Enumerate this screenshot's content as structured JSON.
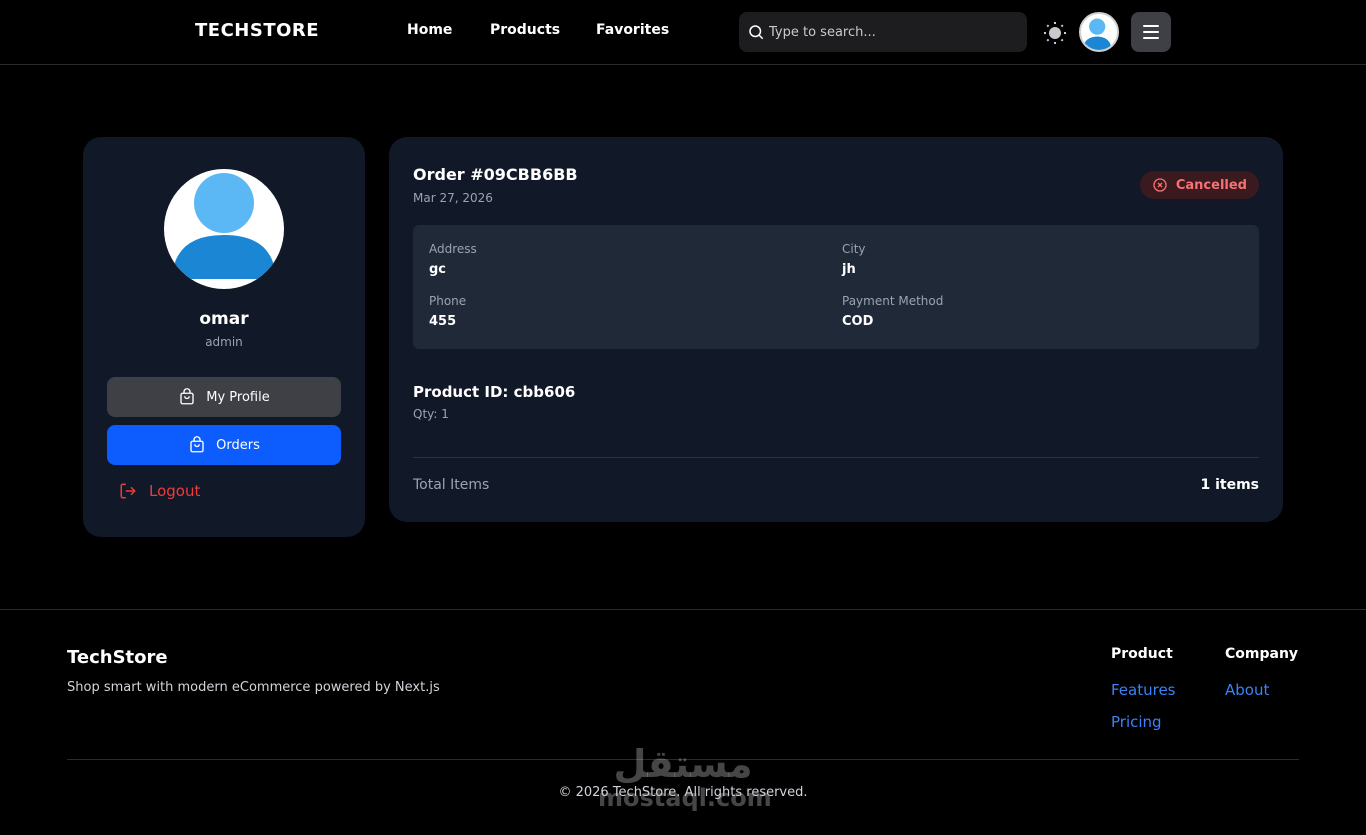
{
  "header": {
    "logo": "TECHSTORE",
    "nav": {
      "home": "Home",
      "products": "Products",
      "favorites": "Favorites"
    },
    "search_placeholder": "Type to search..."
  },
  "sidebar": {
    "username": "omar",
    "role": "admin",
    "my_profile_label": "My Profile",
    "orders_label": "Orders",
    "logout_label": "Logout"
  },
  "order": {
    "title": "Order #09CBB6BB",
    "date": "Mar 27, 2026",
    "status": "Cancelled",
    "address_label": "Address",
    "address": "gc",
    "city_label": "City",
    "city": "jh",
    "phone_label": "Phone",
    "phone": "455",
    "payment_label": "Payment Method",
    "payment": "COD",
    "product_id": "Product ID: cbb606",
    "qty": "Qty: 1",
    "total_label": "Total Items",
    "total_value": "1 items"
  },
  "footer": {
    "brand": "TechStore",
    "tagline": "Shop smart with modern eCommerce powered by Next.js",
    "product_title": "Product",
    "product_links": [
      "Features",
      "Pricing"
    ],
    "company_title": "Company",
    "company_links": [
      "About"
    ],
    "copyright": "© 2026 TechStore. All rights reserved.",
    "watermark_ar": "مستقل",
    "watermark_en": "mostaql.com"
  },
  "colors": {
    "accent": "#0d5cfd",
    "danger": "#ef3b3b",
    "link": "#3b82f6",
    "card": "#111827"
  }
}
